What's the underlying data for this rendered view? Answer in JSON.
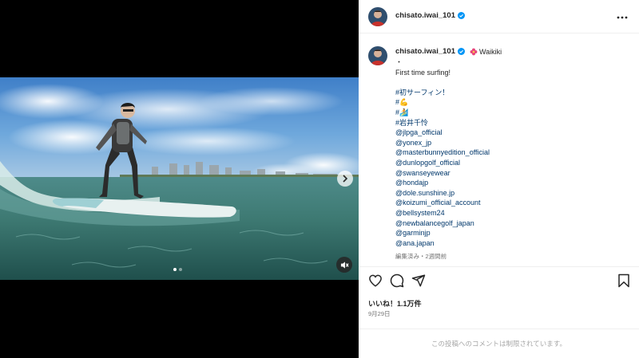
{
  "post": {
    "username": "chisato.iwai_101",
    "verified_color": "#0095f6",
    "location_icon": "flower-icon",
    "location": "Waikiki",
    "caption_lines": [
      {
        "kind": "dot",
        "text": "・"
      },
      {
        "kind": "text",
        "text": "First time surfing!"
      },
      {
        "kind": "blank",
        "text": ""
      },
      {
        "kind": "tag",
        "text": "#初サーフィン！"
      },
      {
        "kind": "tag",
        "text": "#💪"
      },
      {
        "kind": "tag",
        "text": "#🏄"
      },
      {
        "kind": "tag",
        "text": "#岩井千怜"
      },
      {
        "kind": "mention",
        "text": "@jlpga_official"
      },
      {
        "kind": "mention",
        "text": "@yonex_jp"
      },
      {
        "kind": "mention",
        "text": "@masterbunnyedition_official"
      },
      {
        "kind": "mention",
        "text": "@dunlopgolf_official"
      },
      {
        "kind": "mention",
        "text": "@swanseyewear"
      },
      {
        "kind": "mention",
        "text": "@hondajp"
      },
      {
        "kind": "mention",
        "text": "@dole.sunshine.jp"
      },
      {
        "kind": "mention",
        "text": "@koizumi_official_account"
      },
      {
        "kind": "mention",
        "text": "@bellsystem24"
      },
      {
        "kind": "mention",
        "text": "@newbalancegolf_japan"
      },
      {
        "kind": "mention",
        "text": "@garminjp"
      },
      {
        "kind": "mention",
        "text": "@ana.japan"
      }
    ],
    "edited_label": "編集済み・2週間前",
    "likes_label": "いいね！1.1万件",
    "date_label": "9月29日",
    "comments_disabled_label": "この投稿へのコメントは制限されています。"
  },
  "media": {
    "carousel_count": 2,
    "carousel_active": 0
  },
  "icons": {
    "like": "heart-icon",
    "comment": "comment-icon",
    "share": "share-icon",
    "save": "bookmark-icon",
    "more": "more-icon",
    "next": "chevron-right-icon",
    "mute": "muted-speaker-icon"
  },
  "colors": {
    "link": "#00376b",
    "secondary_text": "#737373",
    "divider": "#efefef"
  }
}
